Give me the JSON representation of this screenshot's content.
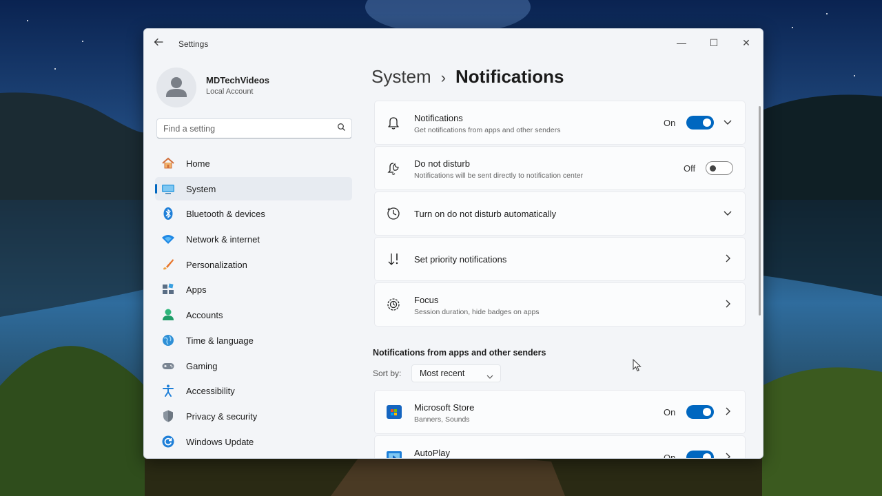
{
  "window": {
    "title": "Settings",
    "controls": {
      "minimize": "—",
      "maximize": "☐",
      "close": "✕"
    }
  },
  "account": {
    "name": "MDTechVideos",
    "type": "Local Account"
  },
  "search": {
    "placeholder": "Find a setting"
  },
  "sidebar": {
    "items": [
      {
        "label": "Home",
        "icon": "home-icon"
      },
      {
        "label": "System",
        "icon": "system-icon",
        "active": true
      },
      {
        "label": "Bluetooth & devices",
        "icon": "bluetooth-icon"
      },
      {
        "label": "Network & internet",
        "icon": "wifi-icon"
      },
      {
        "label": "Personalization",
        "icon": "brush-icon"
      },
      {
        "label": "Apps",
        "icon": "apps-icon"
      },
      {
        "label": "Accounts",
        "icon": "accounts-icon"
      },
      {
        "label": "Time & language",
        "icon": "globe-icon"
      },
      {
        "label": "Gaming",
        "icon": "gaming-icon"
      },
      {
        "label": "Accessibility",
        "icon": "accessibility-icon"
      },
      {
        "label": "Privacy & security",
        "icon": "shield-icon"
      },
      {
        "label": "Windows Update",
        "icon": "update-icon"
      }
    ]
  },
  "breadcrumb": {
    "parent": "System",
    "separator": "›",
    "current": "Notifications"
  },
  "settings": [
    {
      "title": "Notifications",
      "description": "Get notifications from apps and other senders",
      "toggle_label": "On",
      "toggle": true,
      "icon": "bell-icon"
    },
    {
      "title": "Do not disturb",
      "description": "Notifications will be sent directly to notification center",
      "toggle_label": "Off",
      "toggle": false,
      "icon": "do-not-disturb-icon"
    },
    {
      "title": "Turn on do not disturb automatically",
      "icon": "clock-icon"
    },
    {
      "title": "Set priority notifications",
      "icon": "priority-icon"
    },
    {
      "title": "Focus",
      "description": "Session duration, hide badges on apps",
      "icon": "focus-icon"
    }
  ],
  "apps_section": {
    "heading": "Notifications from apps and other senders",
    "sort_label": "Sort by:",
    "sort_value": "Most recent",
    "apps": [
      {
        "name": "Microsoft Store",
        "description": "Banners, Sounds",
        "toggle_label": "On",
        "toggle": true,
        "icon": "store-icon"
      },
      {
        "name": "AutoPlay",
        "description": "",
        "toggle_label": "On",
        "toggle": true,
        "icon": "autoplay-icon"
      }
    ]
  },
  "colors": {
    "accent": "#0067c0",
    "window_bg": "#f3f5f8",
    "card_bg": "#fbfcfd"
  }
}
